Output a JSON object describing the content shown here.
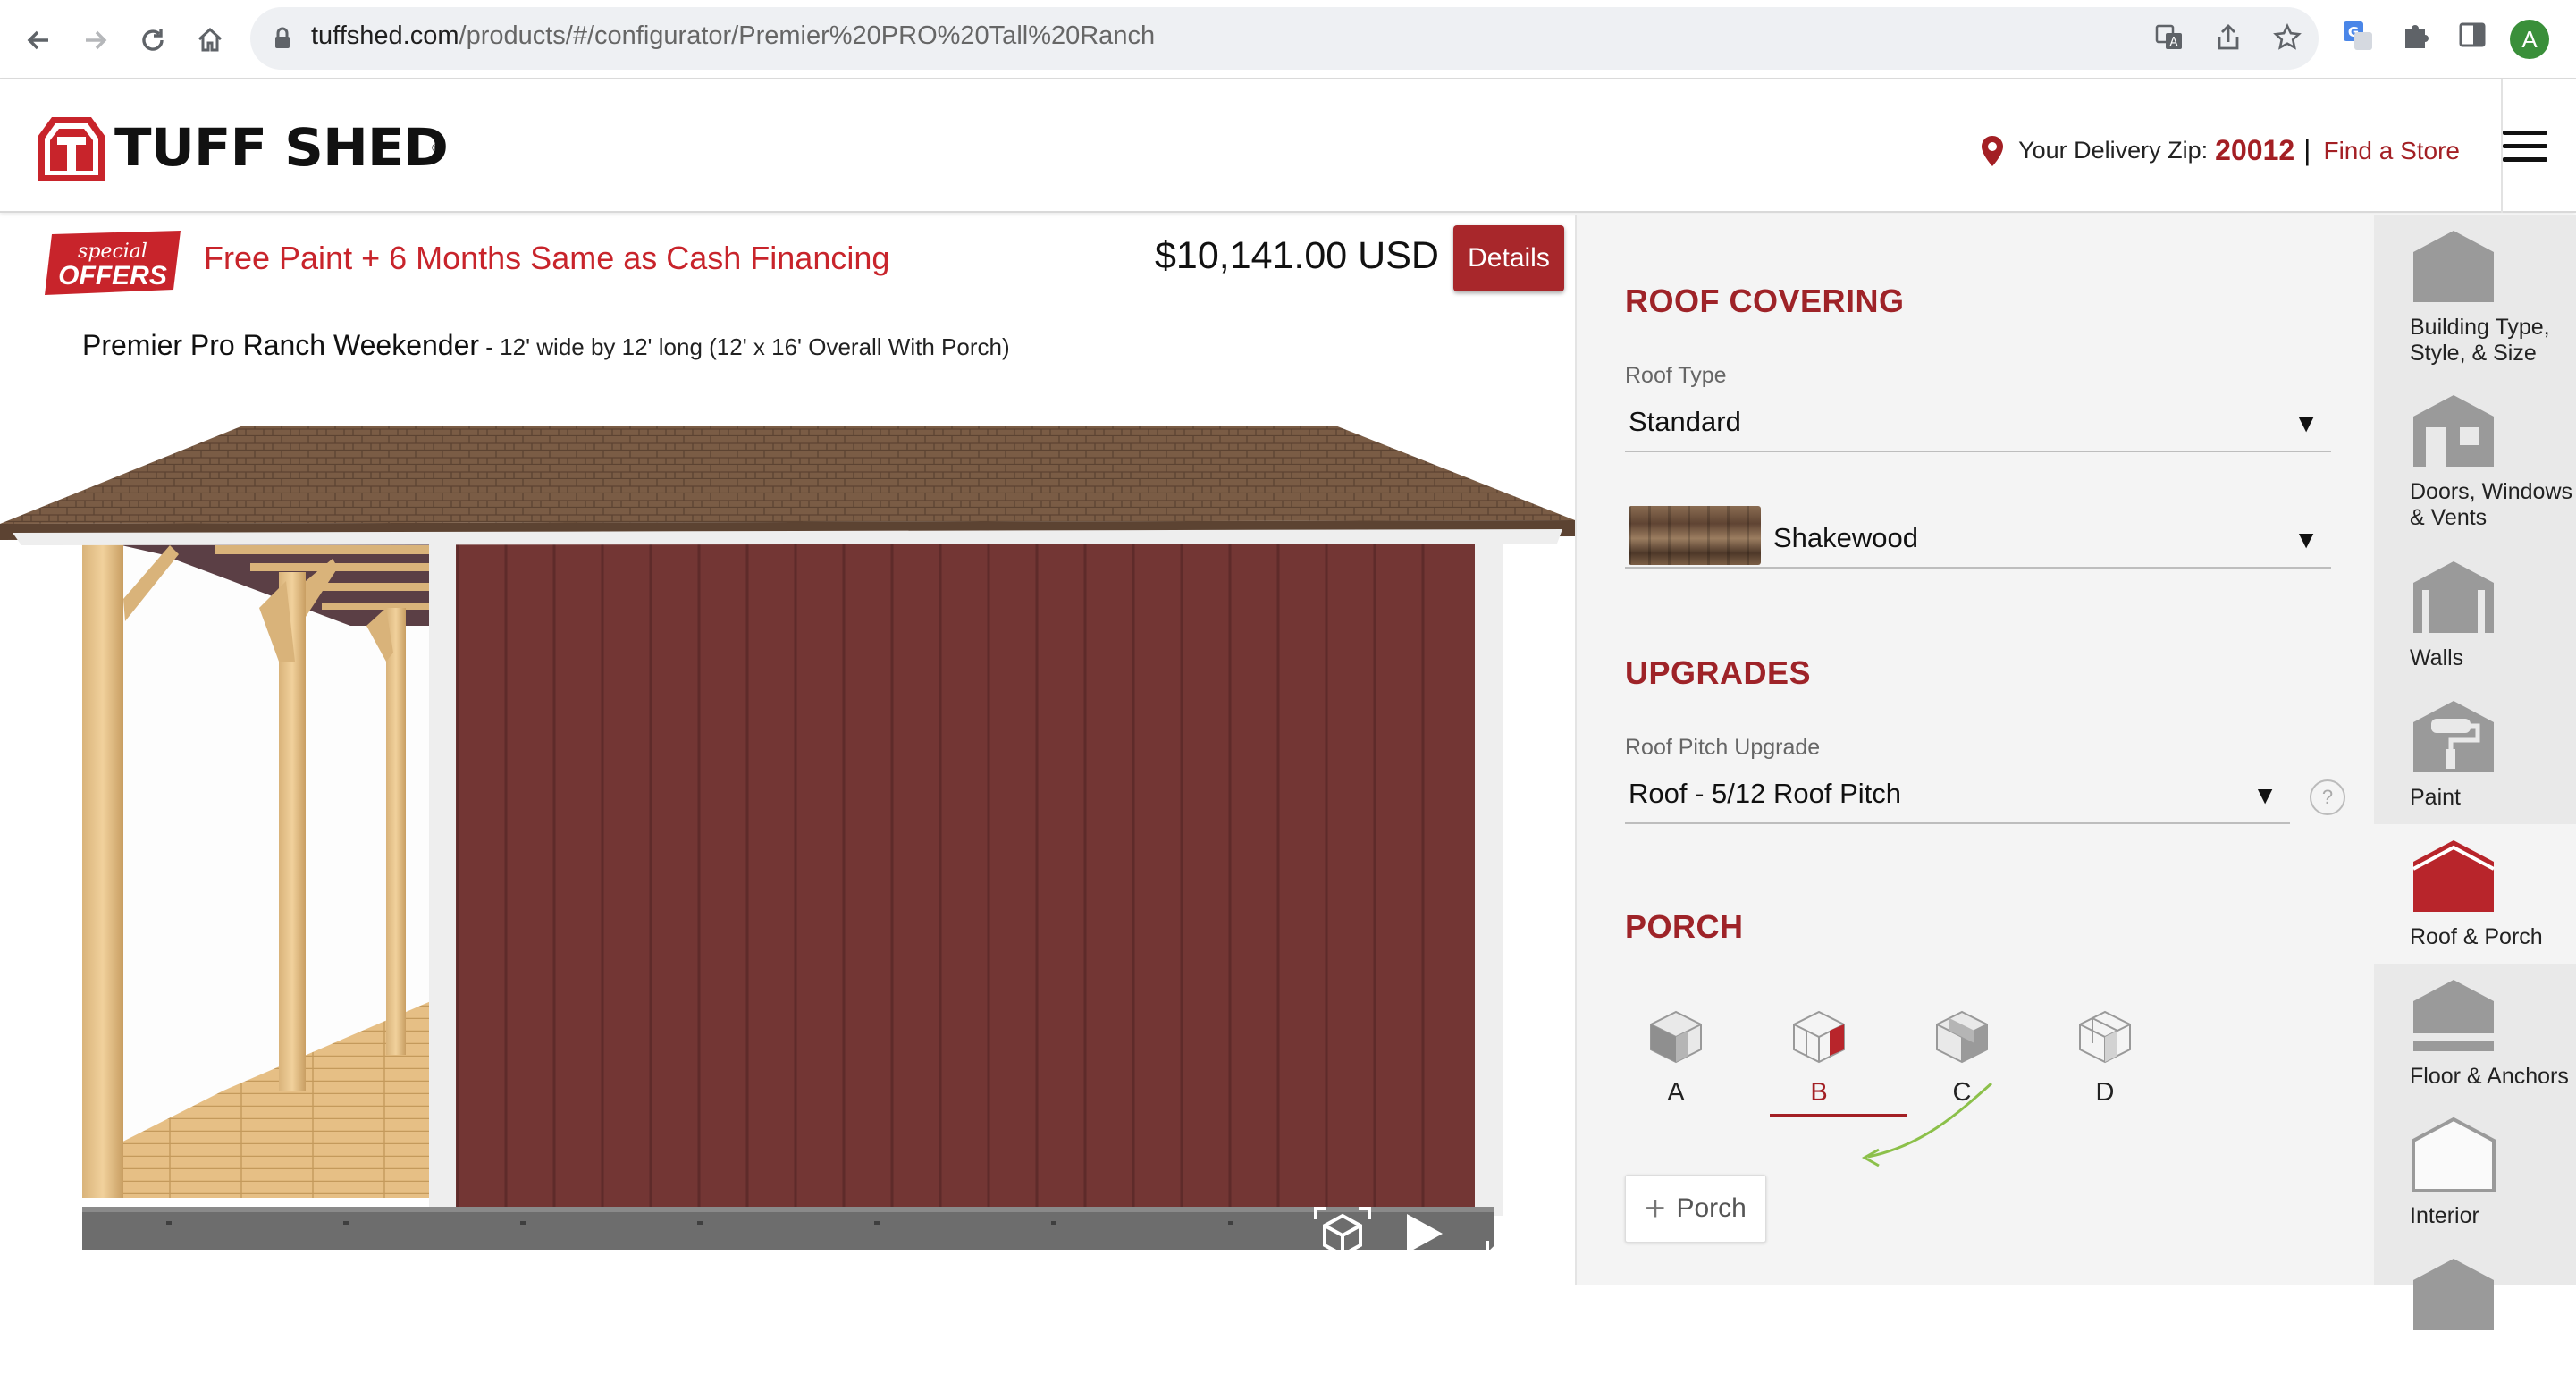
{
  "browser": {
    "url_domain": "tuffshed.com",
    "url_path": "/products/#/configurator/Premier%20PRO%20Tall%20Ranch",
    "profile_initial": "A"
  },
  "header": {
    "logo_text": "TUFF SHED",
    "delivery_label": "Your Delivery Zip:",
    "delivery_zip": "20012",
    "separator": "|",
    "find_store": "Find a Store"
  },
  "promo": {
    "badge_top": "special",
    "badge_bottom": "OFFERS",
    "text": "Free Paint + 6 Months Same as Cash Financing"
  },
  "price": "$10,141.00 USD",
  "details_button": "Details",
  "product": {
    "name": "Premier Pro Ranch Weekender",
    "dimensions": " - 12' wide by 12' long (12' x 16' Overall With Porch)"
  },
  "roof_covering": {
    "title": "ROOF COVERING",
    "roof_type_label": "Roof Type",
    "roof_type_value": "Standard",
    "shingle_value": "Shakewood"
  },
  "upgrades": {
    "title": "UPGRADES",
    "pitch_label": "Roof Pitch Upgrade",
    "pitch_value": "Roof - 5/12 Roof Pitch",
    "help": "?"
  },
  "porch": {
    "title": "PORCH",
    "options": [
      "A",
      "B",
      "C",
      "D"
    ],
    "selected": "B",
    "add_button": "Porch"
  },
  "categories": [
    {
      "label": "Building Type, Style, & Size",
      "icon": "building-icon"
    },
    {
      "label": "Doors, Windows & Vents",
      "icon": "doors-icon"
    },
    {
      "label": "Walls",
      "icon": "walls-icon"
    },
    {
      "label": "Paint",
      "icon": "paint-roller-icon"
    },
    {
      "label": "Roof & Porch",
      "icon": "roof-icon",
      "active": true
    },
    {
      "label": "Floor & Anchors",
      "icon": "floor-icon"
    },
    {
      "label": "Interior",
      "icon": "interior-icon"
    }
  ],
  "colors": {
    "brand_red": "#a31f24",
    "siding": "#733634",
    "roof_shingle": "#7a5c45",
    "arrow_green": "#8cc04a"
  }
}
